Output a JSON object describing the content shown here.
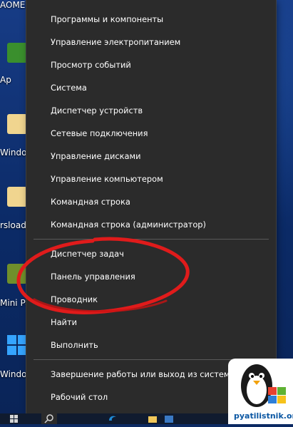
{
  "desktop": {
    "icons": [
      {
        "label": "AOMEI Partition",
        "name": "desktop-icon-aomei-partition"
      },
      {
        "label": "Ap",
        "name": "desktop-icon-app"
      },
      {
        "label": "Window",
        "name": "desktop-icon-windows-1"
      },
      {
        "label": "rsload.n",
        "name": "desktop-icon-rsload"
      },
      {
        "label": "Mini Partition",
        "name": "desktop-icon-mini-partition"
      },
      {
        "label": "Window",
        "name": "desktop-icon-windows-2"
      }
    ]
  },
  "context_menu": {
    "groups": [
      {
        "items": [
          "Программы и компоненты",
          "Управление электропитанием",
          "Просмотр событий",
          "Система",
          "Диспетчер устройств",
          "Сетевые подключения",
          "Управление дисками",
          "Управление компьютером",
          "Командная строка",
          "Командная строка (администратор)"
        ]
      },
      {
        "items": [
          "Диспетчер задач",
          "Панель управления",
          "Проводник",
          "Найти",
          "Выполнить"
        ]
      },
      {
        "items": [
          "Завершение работы или выход из системы",
          "Рабочий стол"
        ]
      }
    ]
  },
  "annotation": {
    "highlight_color": "#e01b1b"
  },
  "watermark": {
    "text": "pyatilistnik.org"
  },
  "taskbar": {
    "accent": "#1e8ad6"
  }
}
